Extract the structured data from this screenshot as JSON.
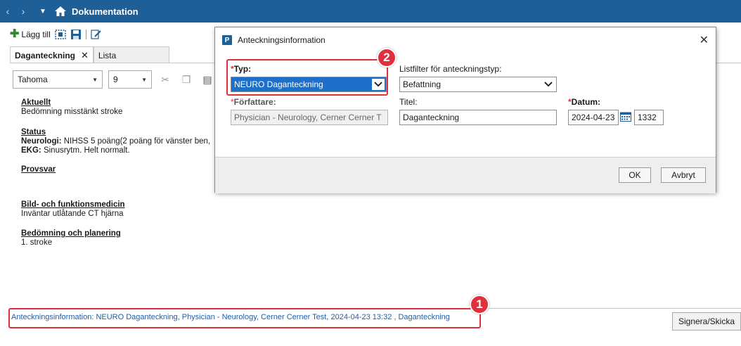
{
  "topbar": {
    "title": "Dokumentation"
  },
  "toolbar": {
    "add_label": "Lägg till"
  },
  "tabs": [
    {
      "label": "Daganteckning"
    },
    {
      "label": "Lista"
    }
  ],
  "format": {
    "font": "Tahoma",
    "size": "9"
  },
  "document": {
    "aktuellt_heading": "Aktuellt",
    "aktuellt_text": "Bedömning misstänkt stroke",
    "status_heading": "Status",
    "neuro_label": "Neurologi:",
    "neuro_text": " NIHSS 5 poäng(2 poäng för vänster ben,",
    "ekg_label": "EKG:",
    "ekg_text": " Sinusrytm. Helt normalt.",
    "provsvar_heading": "Provsvar",
    "bild_heading": "Bild- och funktionsmedicin",
    "bild_text": "Inväntar utlåtande CT hjärna",
    "bedomning_heading": "Bedömning och planering",
    "bedomning_text": "1. stroke"
  },
  "info_line": "Anteckningsinformation: NEURO Daganteckning, Physician - Neurology, Cerner Cerner Test, 2024-04-23 13:32 , Daganteckning",
  "sign_button": "Signera/Skicka",
  "callouts": {
    "one": "1",
    "two": "2"
  },
  "dialog": {
    "title": "Anteckningsinformation",
    "typ_label": "Typ:",
    "typ_value": "NEURO Daganteckning",
    "listfilter_label": "Listfilter för anteckningstyp:",
    "listfilter_value": "Befattning",
    "forfattare_label": "Författare:",
    "forfattare_value": "Physician - Neurology, Cerner Cerner T",
    "titel_label": "Titel:",
    "titel_value": "Daganteckning",
    "datum_label": "Datum:",
    "datum_value": "2024-04-23",
    "time_value": "1332",
    "required_mark": "*",
    "ok": "OK",
    "cancel": "Avbryt"
  },
  "colors": {
    "topbar": "#1f5f97",
    "callout": "#e0303b",
    "link": "#1f5fa8",
    "selection": "#1e6fc9"
  }
}
